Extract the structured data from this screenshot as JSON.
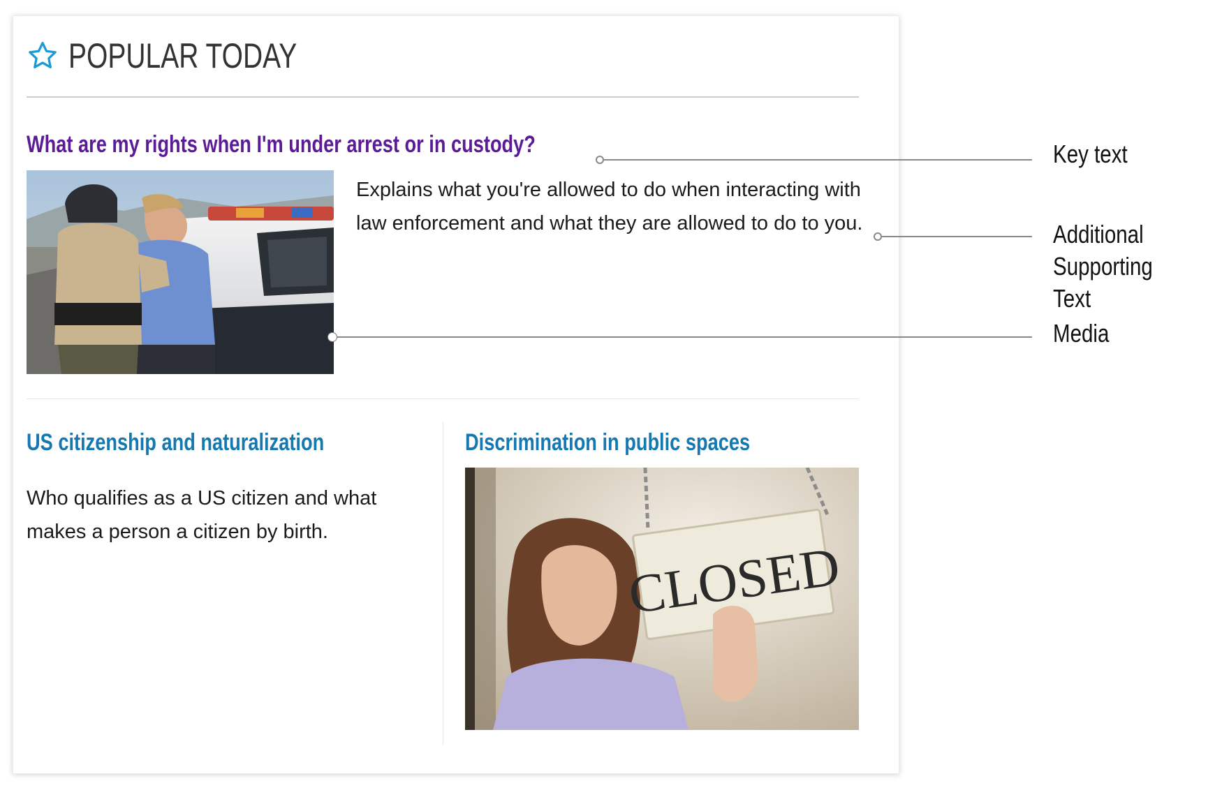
{
  "header": {
    "title": "POPULAR TODAY",
    "icon": "star-icon",
    "icon_color": "#1a9ad6"
  },
  "feature": {
    "headline": "What are my rights when I'm under arrest or in custody?",
    "description": "Explains what you're allowed to do when interacting with law enforcement and what they are allowed to do to you.",
    "image": "police-arrest-photo",
    "headline_color": "#5b1a96"
  },
  "articles": [
    {
      "headline": "US citizenship and naturalization",
      "description": "Who qualifies as a US citizen and what makes a person a citizen by birth."
    },
    {
      "headline": "Discrimination in public spaces",
      "image": "closed-sign-photo",
      "image_text": "CLOSED"
    }
  ],
  "link_color": "#1678b0",
  "callouts": [
    {
      "label": "Key text"
    },
    {
      "label": "Additional Supporting Text"
    },
    {
      "label": "Media"
    }
  ]
}
